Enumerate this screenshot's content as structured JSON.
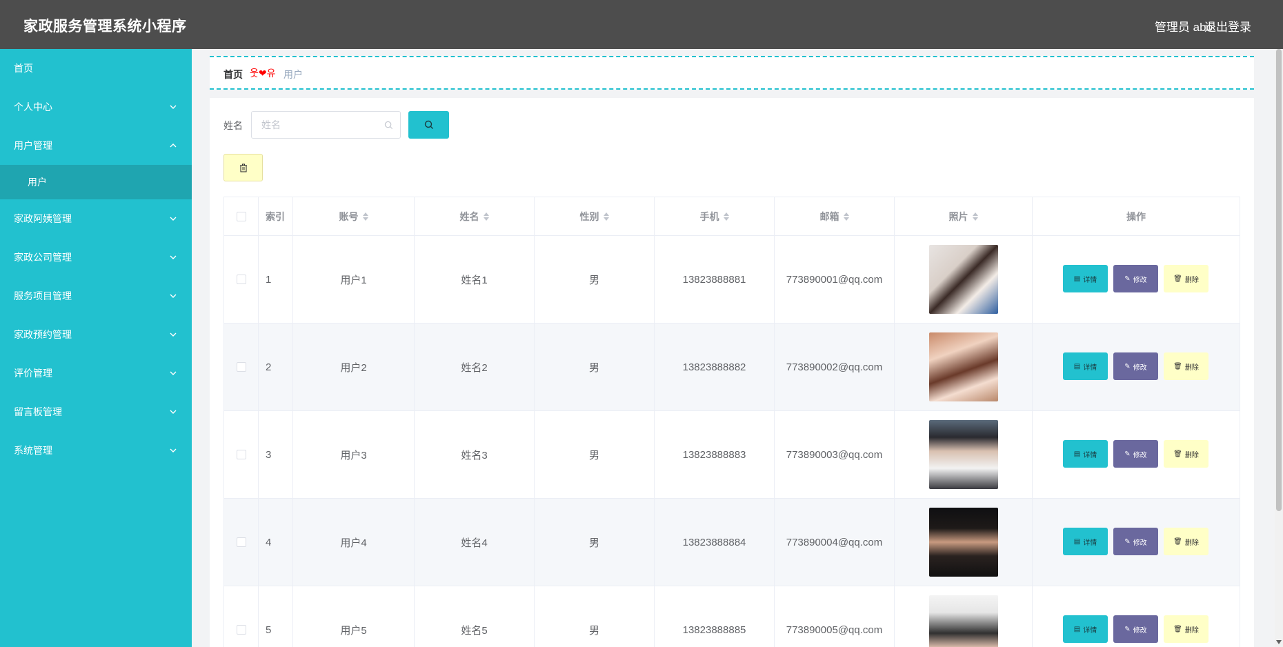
{
  "header": {
    "title": "家政服务管理系统小程序",
    "user": "管理员 abo",
    "logout": "退出登录"
  },
  "sidebar": {
    "items": [
      {
        "label": "首页",
        "chevron": "none"
      },
      {
        "label": "个人中心",
        "chevron": "down"
      },
      {
        "label": "用户管理",
        "chevron": "up"
      },
      {
        "label": "家政阿姨管理",
        "chevron": "down"
      },
      {
        "label": "家政公司管理",
        "chevron": "down"
      },
      {
        "label": "服务项目管理",
        "chevron": "down"
      },
      {
        "label": "家政预约管理",
        "chevron": "down"
      },
      {
        "label": "评价管理",
        "chevron": "down"
      },
      {
        "label": "留言板管理",
        "chevron": "down"
      },
      {
        "label": "系统管理",
        "chevron": "down"
      }
    ],
    "subitem": "用户"
  },
  "breadcrumb": {
    "home": "首页",
    "separator": "웃❤유",
    "current": "用户"
  },
  "search": {
    "label": "姓名",
    "placeholder": "姓名"
  },
  "table": {
    "headers": {
      "index": "索引",
      "account": "账号",
      "name": "姓名",
      "gender": "性别",
      "phone": "手机",
      "email": "邮箱",
      "photo": "照片",
      "ops": "操作"
    },
    "buttons": {
      "detail": "详情",
      "edit": "修改",
      "delete": "删除"
    },
    "rows": [
      {
        "index": "1",
        "account": "用户1",
        "name": "姓名1",
        "gender": "男",
        "phone": "13823888881",
        "email": "773890001@qq.com"
      },
      {
        "index": "2",
        "account": "用户2",
        "name": "姓名2",
        "gender": "男",
        "phone": "13823888882",
        "email": "773890002@qq.com"
      },
      {
        "index": "3",
        "account": "用户3",
        "name": "姓名3",
        "gender": "男",
        "phone": "13823888883",
        "email": "773890003@qq.com"
      },
      {
        "index": "4",
        "account": "用户4",
        "name": "姓名4",
        "gender": "男",
        "phone": "13823888884",
        "email": "773890004@qq.com"
      },
      {
        "index": "5",
        "account": "用户5",
        "name": "姓名5",
        "gender": "男",
        "phone": "13823888885",
        "email": "773890005@qq.com"
      }
    ]
  },
  "colors": {
    "header_bg": "#4d4d4d",
    "sidebar_bg": "#22c1cf",
    "sidebar_active": "#1fa5b0",
    "detail_btn": "#22c1cf",
    "edit_btn": "#6a689e",
    "delete_btn": "#ffffc7"
  }
}
